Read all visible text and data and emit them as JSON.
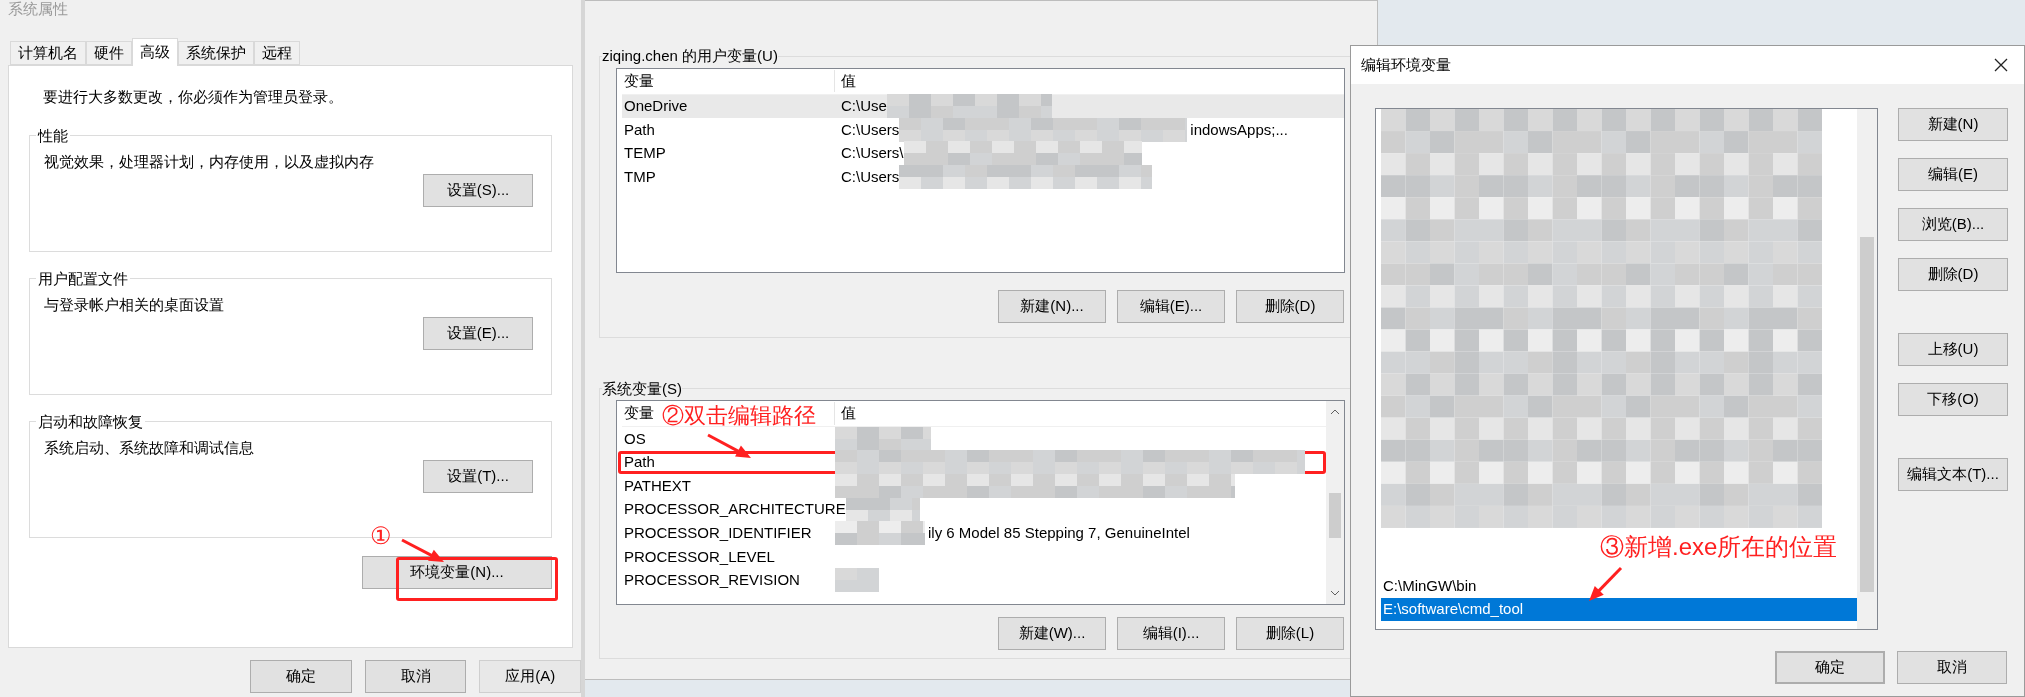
{
  "system_properties": {
    "title": "系统属性",
    "tabs": [
      {
        "label": "计算机名",
        "selected": false
      },
      {
        "label": "硬件",
        "selected": false
      },
      {
        "label": "高级",
        "selected": true
      },
      {
        "label": "系统保护",
        "selected": false
      },
      {
        "label": "远程",
        "selected": false
      }
    ],
    "notice": "要进行大多数更改，你必须作为管理员登录。",
    "groups": [
      {
        "title": "性能",
        "description": "视觉效果，处理器计划，内存使用，以及虚拟内存",
        "button": "设置(S)..."
      },
      {
        "title": "用户配置文件",
        "description": "与登录帐户相关的桌面设置",
        "button": "设置(E)..."
      },
      {
        "title": "启动和故障恢复",
        "description": "系统启动、系统故障和调试信息",
        "button": "设置(T)..."
      }
    ],
    "env_button": "环境变量(N)...",
    "buttons": [
      {
        "label": "确定",
        "disabled": false
      },
      {
        "label": "取消",
        "disabled": false
      },
      {
        "label": "应用(A)",
        "disabled": true
      }
    ]
  },
  "environment_variables": {
    "user_group": {
      "title": "ziqing.chen 的用户变量(U)",
      "columns": [
        "变量",
        "值"
      ],
      "rows": [
        {
          "name": "OneDrive",
          "value": "C:\\Use",
          "selected": true
        },
        {
          "name": "Path",
          "value": "C:\\Users",
          "value_end": "indowsApps;...",
          "selected": false
        },
        {
          "name": "TEMP",
          "value": "C:\\Users\\",
          "selected": false
        },
        {
          "name": "TMP",
          "value": "C:\\Users",
          "selected": false
        }
      ],
      "buttons": [
        "新建(N)...",
        "编辑(E)...",
        "删除(D)"
      ]
    },
    "system_group": {
      "title": "系统变量(S)",
      "columns": [
        "变量",
        "值"
      ],
      "rows": [
        {
          "name": "OS",
          "selected": false,
          "highlighted": false
        },
        {
          "name": "Path",
          "selected": false,
          "highlighted": true
        },
        {
          "name": "PATHEXT",
          "selected": false,
          "highlighted": false
        },
        {
          "name": "PROCESSOR_ARCHITECTURE",
          "selected": false,
          "highlighted": false
        },
        {
          "name": "PROCESSOR_IDENTIFIER",
          "value_end": "ily 6 Model 85 Stepping 7, GenuineIntel",
          "selected": false,
          "highlighted": false
        },
        {
          "name": "PROCESSOR_LEVEL",
          "selected": false,
          "highlighted": false
        },
        {
          "name": "PROCESSOR_REVISION",
          "selected": false,
          "highlighted": false
        }
      ],
      "buttons": [
        "新建(W)...",
        "编辑(I)...",
        "删除(L)"
      ]
    }
  },
  "edit_dialog": {
    "title": "编辑环境变量",
    "items": [
      {
        "text": "C:\\MinGW\\bin",
        "selected": false
      },
      {
        "text": "E:\\software\\cmd_tool",
        "selected": true
      }
    ],
    "side_buttons": [
      "新建(N)",
      "编辑(E)",
      "浏览(B)...",
      "删除(D)",
      "上移(U)",
      "下移(O)",
      "编辑文本(T)..."
    ],
    "buttons": [
      {
        "label": "确定",
        "default": true
      },
      {
        "label": "取消",
        "default": false
      }
    ]
  },
  "annotations": [
    "①",
    "②双击编辑路径",
    "③新增.exe所在的位置"
  ]
}
